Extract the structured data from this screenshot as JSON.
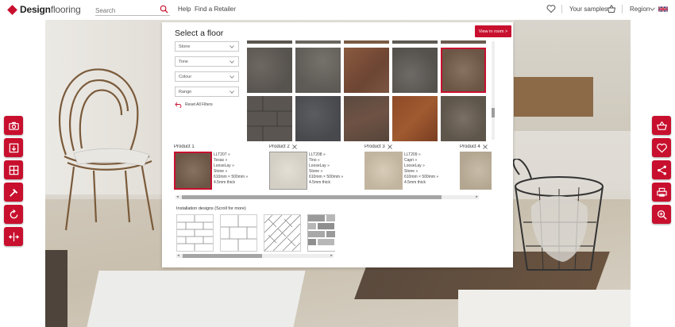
{
  "header": {
    "logo_bold": "Design",
    "logo_light": "flooring",
    "search_placeholder": "Search",
    "help": "Help",
    "find_retailer": "Find a Retailer",
    "your_samples": "Your samples",
    "region": "Region"
  },
  "panel": {
    "title": "Select a floor",
    "view_in_room": "View in room >",
    "filters": [
      "Stone",
      "Tone",
      "Colour",
      "Range"
    ],
    "reset_label": "Reset All Filters",
    "products": [
      {
        "label": "Product 1",
        "removable": false,
        "info": [
          "LLT207 »",
          "Texas »",
          "LooseLay »",
          "Stone »",
          "610mm × 500mm »",
          "4.5mm thick"
        ]
      },
      {
        "label": "Product 2",
        "removable": true,
        "info": [
          "LLT208 »",
          "Tino »",
          "LooseLay »",
          "Stone »",
          "610mm × 500mm »",
          "4.5mm thick"
        ]
      },
      {
        "label": "Product 3",
        "removable": true,
        "info": [
          "LLT209 »",
          "Capri »",
          "LooseLay »",
          "Stone »",
          "610mm × 500mm »",
          "4.5mm thick"
        ]
      },
      {
        "label": "Product 4",
        "removable": true,
        "info": []
      }
    ],
    "installation_label": "Installation designs (Scroll for more)"
  },
  "colors": {
    "accent": "#c8102e"
  }
}
